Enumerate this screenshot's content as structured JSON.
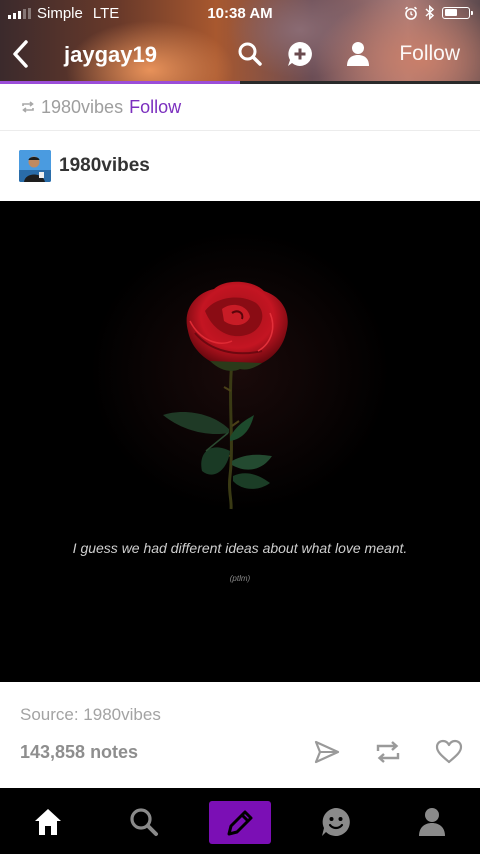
{
  "status_bar": {
    "carrier": "Simple",
    "network": "LTE",
    "time": "10:38 AM",
    "battery_percent": 60
  },
  "nav": {
    "title": "jaygay19",
    "follow_label": "Follow",
    "progress_fraction": 0.5
  },
  "reblog": {
    "name": "1980vibes",
    "follow_label": "Follow"
  },
  "author": {
    "name": "1980vibes"
  },
  "post": {
    "caption": "I guess we had different ideas about what love meant.",
    "subcaption": "(ptlm)"
  },
  "footer": {
    "source": "Source: 1980vibes",
    "notes": "143,858 notes"
  },
  "colors": {
    "accent": "#7b2fbe",
    "compose_bg": "#7b0fb5",
    "tabbar_bg": "#000000"
  },
  "icons": {
    "nav": [
      "back-chevron-icon",
      "search-icon",
      "add-circle-icon",
      "user-icon"
    ],
    "actions": [
      "share-icon",
      "reblog-icon",
      "heart-icon"
    ],
    "tabs": [
      "home-icon",
      "search-icon",
      "compose-pencil-icon",
      "chat-icon",
      "account-icon"
    ]
  }
}
